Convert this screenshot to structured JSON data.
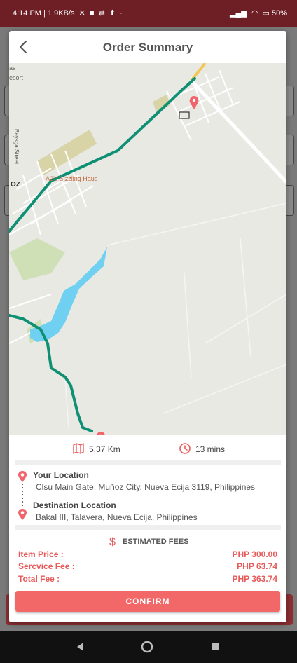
{
  "status_bar": {
    "time": "4:14 PM",
    "speed": "1.9KB/s",
    "battery": "50"
  },
  "header": {
    "title": "Order Summary"
  },
  "map": {
    "labels": {
      "resort_a": "as",
      "resort_b": "esort",
      "street": "Baysga Street",
      "business": "A2's Sizzling Haus",
      "area": "OZ"
    }
  },
  "trip": {
    "distance": "5.37 Km",
    "duration": "13 mins"
  },
  "locations": {
    "origin_title": "Your Location",
    "origin_address": "Clsu Main Gate, Muñoz City, Nueva Ecija 3119, Philippines",
    "destination_title": "Destination Location",
    "destination_address": "Bakal III, Talavera, Nueva Ecija, Philippines"
  },
  "fees": {
    "title": "ESTIMATED FEES",
    "items": [
      {
        "label": "Item Price :",
        "value": "PHP 300.00"
      },
      {
        "label": "Sercvice Fee :",
        "value": "PHP 63.74"
      },
      {
        "label": "Total Fee :",
        "value": "PHP 363.74"
      }
    ]
  },
  "actions": {
    "confirm_label": "CONFIRM"
  },
  "colors": {
    "accent": "#f26868",
    "fee_text": "#e85a5a",
    "route": "#0f8f73",
    "status_bar": "#6e1f25"
  }
}
